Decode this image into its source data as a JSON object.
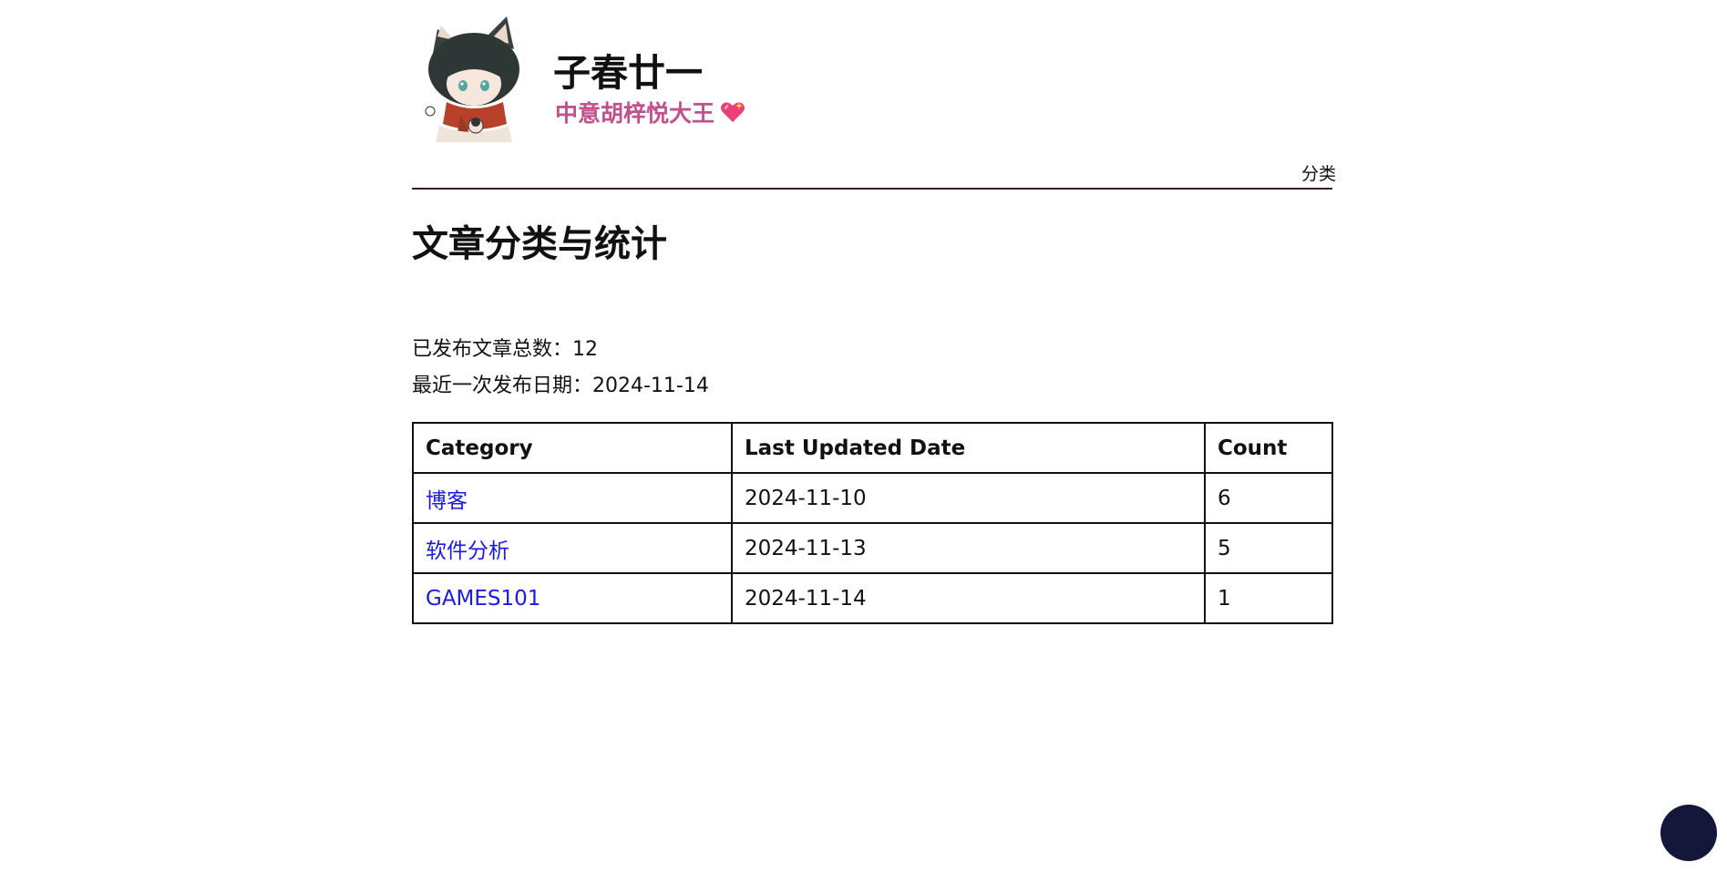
{
  "site": {
    "title": "子春廿一",
    "subtitle": "中意胡梓悦大王",
    "nav_categories": "分类"
  },
  "page": {
    "title": "文章分类与统计",
    "total_label": "已发布文章总数：12",
    "last_label": "最近一次发布日期：2024-11-14"
  },
  "table": {
    "headers": {
      "category": "Category",
      "date": "Last Updated Date",
      "count": "Count"
    },
    "rows": [
      {
        "category": "博客",
        "date": "2024-11-10",
        "count": "6"
      },
      {
        "category": "软件分析",
        "date": "2024-11-13",
        "count": "5"
      },
      {
        "category": "GAMES101",
        "date": "2024-11-14",
        "count": "1"
      }
    ]
  },
  "colors": {
    "subtitle": "#c2508e",
    "link": "#1a1ae6",
    "divider": "#3a1a2c",
    "fab": "#14173a"
  }
}
